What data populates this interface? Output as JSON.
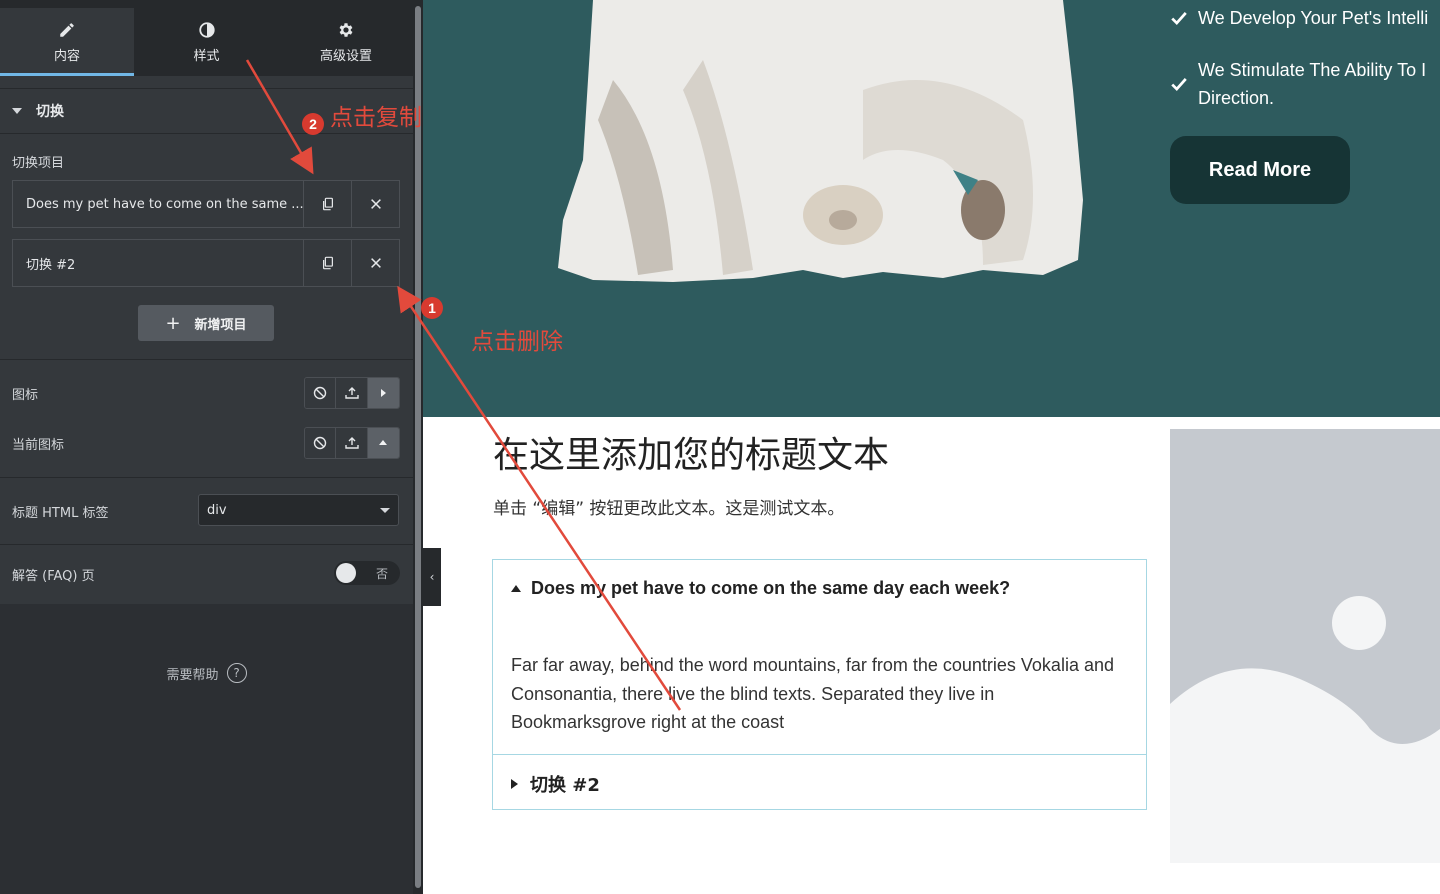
{
  "panel": {
    "tabs": [
      {
        "label": "内容",
        "icon": "pencil-icon"
      },
      {
        "label": "样式",
        "icon": "contrast-icon"
      },
      {
        "label": "高级设置",
        "icon": "gear-icon"
      }
    ],
    "section_title": "切换",
    "repeater_label": "切换项目",
    "items": [
      {
        "title": "Does my pet have to come on the same ..."
      },
      {
        "title": "切换 #2"
      }
    ],
    "add_item_label": "新增项目",
    "icon_label": "图标",
    "active_icon_label": "当前图标",
    "title_html_tag_label": "标题 HTML 标签",
    "title_html_tag_value": "div",
    "faq_label": "解答 (FAQ) 页",
    "faq_toggle_text": "否",
    "help_label": "需要帮助",
    "help_icon": "?"
  },
  "hero": {
    "features": [
      "We Develop Your Pet's Intelli",
      "We Stimulate The Ability To I\nDirection."
    ],
    "read_more": "Read More",
    "bg_color": "#2e5b5e"
  },
  "content": {
    "heading": "在这里添加您的标题文本",
    "subtext": "单击 “编辑” 按钮更改此文本。这是测试文本。",
    "accordion": [
      {
        "title": "Does my pet have to come on the same day each week?",
        "body": "Far far away, behind the word mountains, far from the countries Vokalia and Consonantia, there live the blind texts. Separated they live in Bookmarksgrove right at the coast"
      },
      {
        "title": "切换 #2"
      }
    ]
  },
  "annotations": {
    "step1_number": "1",
    "step1_text": "点击删除",
    "step2_number": "2",
    "step2_text": "点击复制",
    "color": "#e24a3c"
  }
}
